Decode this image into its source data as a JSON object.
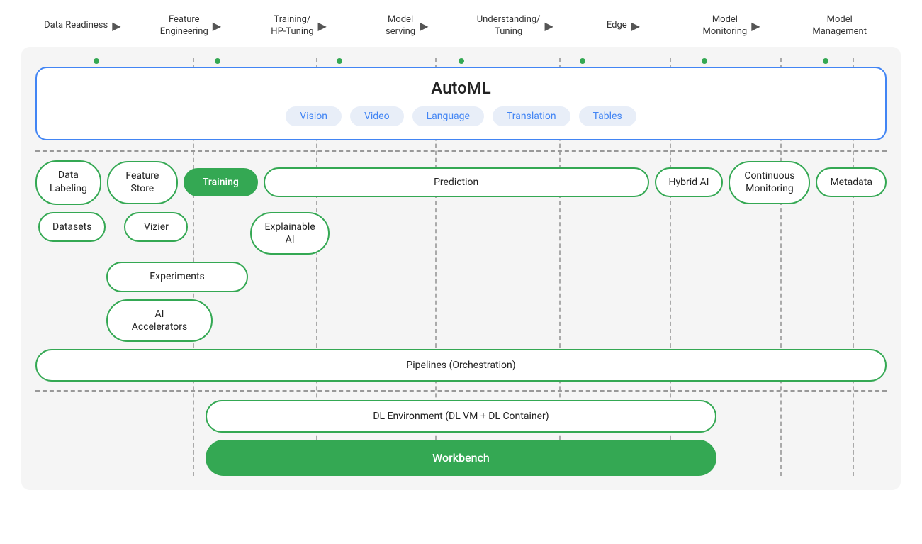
{
  "pipeline": {
    "steps": [
      {
        "label": "Data\nReadiness",
        "hasArrow": false
      },
      {
        "label": "Feature\nEngineering",
        "hasArrow": true
      },
      {
        "label": "Training/\nHP-Tuning",
        "hasArrow": true
      },
      {
        "label": "Model\nserving",
        "hasArrow": true
      },
      {
        "label": "Understanding/\nTuning",
        "hasArrow": true
      },
      {
        "label": "Edge",
        "hasArrow": true
      },
      {
        "label": "Model\nMonitoring",
        "hasArrow": true
      },
      {
        "label": "Model\nManagement",
        "hasArrow": true
      }
    ]
  },
  "automl": {
    "title": "AutoML",
    "chips": [
      "Vision",
      "Video",
      "Language",
      "Translation",
      "Tables"
    ]
  },
  "features": {
    "row1": [
      {
        "label": "Data\nLabeling",
        "filled": false
      },
      {
        "label": "Feature\nStore",
        "filled": false
      },
      {
        "label": "Training",
        "filled": true
      },
      {
        "label": "Prediction",
        "filled": false,
        "wide": true
      },
      {
        "label": "Hybrid AI",
        "filled": false
      },
      {
        "label": "Continuous\nMonitoring",
        "filled": false
      },
      {
        "label": "Metadata",
        "filled": false
      }
    ],
    "row2": [
      {
        "label": "Datasets",
        "filled": false
      },
      {
        "label": "Vizier",
        "filled": false
      }
    ],
    "explainableAI": {
      "label": "Explainable\nAI",
      "filled": false
    },
    "row3": [
      {
        "label": "Experiments",
        "filled": false
      }
    ],
    "row4": [
      {
        "label": "AI\nAccelerators",
        "filled": false
      }
    ],
    "pipelines": {
      "label": "Pipelines (Orchestration)",
      "filled": false,
      "wide": true
    }
  },
  "bottom": {
    "dlEnv": {
      "label": "DL Environment (DL VM + DL Container)"
    },
    "workbench": {
      "label": "Workbench"
    }
  },
  "colors": {
    "green": "#34a853",
    "blue": "#4285f4",
    "lightBlue": "#e8eef8",
    "gray": "#f5f5f5",
    "dashedLine": "#aaa"
  }
}
